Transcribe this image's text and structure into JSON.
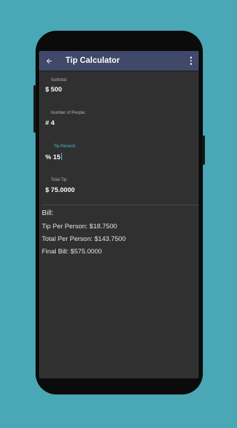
{
  "appbar": {
    "title": "Tip Calculator"
  },
  "fields": {
    "subtotal": {
      "label": "Subtotal:",
      "value": "$ 500"
    },
    "people": {
      "label": "Number of People:",
      "value": "# 4"
    },
    "tip_percent": {
      "label": "Tip Percent:",
      "value": "% 15"
    },
    "total_tip": {
      "label": "Total Tip:",
      "value": "$ 75.0000"
    }
  },
  "bill": {
    "heading": "Bill:",
    "tip_per_person": "Tip Per Person: $18.7500",
    "total_per_person": "Total Per Person: $143.7500",
    "final_bill": "Final Bill: $575.0000"
  },
  "colors": {
    "background": "#4aa7b5",
    "appbar": "#40496a",
    "screen": "#303030",
    "accent": "#52c0d6"
  },
  "icons": {
    "back": "arrow-left",
    "menu": "more-vertical"
  }
}
